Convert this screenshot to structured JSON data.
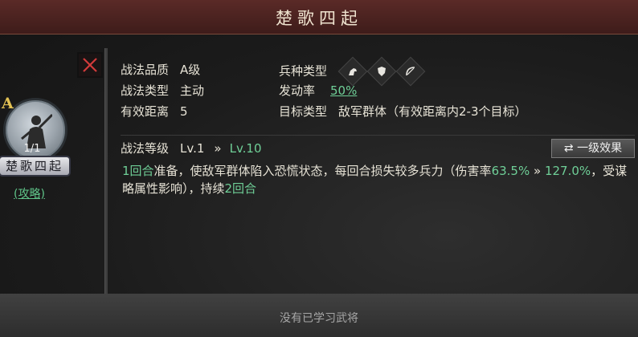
{
  "title": "楚歌四起",
  "general": {
    "grade": "A",
    "count": "1/1",
    "name": "楚歌四起",
    "guide_link": "(攻略)"
  },
  "details": {
    "quality_label": "战法品质",
    "quality_value": "A级",
    "type_label": "战法类型",
    "type_value": "主动",
    "range_label": "有效距离",
    "range_value": "5",
    "troop_label": "兵种类型",
    "troop_icons": [
      "cavalry-icon",
      "shield-icon",
      "bow-icon"
    ],
    "trigger_label": "发动率",
    "trigger_value": "50%",
    "target_label": "目标类型",
    "target_value": "敌军群体（有效距离内2-3个目标）",
    "level_label": "战法等级",
    "level_from": "Lv.1",
    "level_arrow": "»",
    "level_to": "Lv.10"
  },
  "effect_button": "一级效果",
  "description": {
    "p1": "1回合",
    "p2": "准备，使敌军群体陷入恐慌状态，每回合损失较多兵力（伤害率",
    "p3": "63.5%",
    "p4": " » ",
    "p5": "127.0%",
    "p6": "，受谋略属性影响），持续",
    "p7": "2回合"
  },
  "bottom_hint": "没有已学习武将",
  "colors": {
    "accent_green": "#6fcf97",
    "title_bar": "#4a2321",
    "grade_gold": "#e2c154",
    "close_red": "#d23b3b"
  }
}
